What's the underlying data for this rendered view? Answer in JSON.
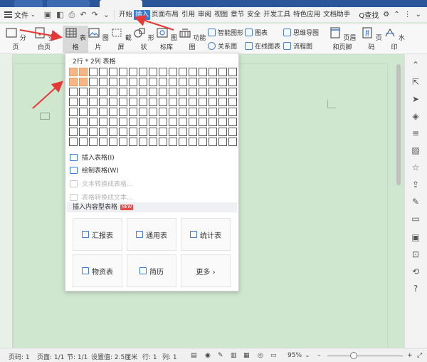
{
  "menu": {
    "file_label": "文件",
    "tabs": [
      "开始",
      "插入",
      "页面布局",
      "引用",
      "审阅",
      "视图",
      "章节",
      "安全",
      "开发工具",
      "特色应用",
      "文档助手"
    ],
    "selected_tab": "插入",
    "search_label": "Q查找"
  },
  "ribbon": {
    "left_buttons": [
      "分页",
      "空白页"
    ],
    "table_button": "表格",
    "buttons": [
      "图片",
      "截屏",
      "形状",
      "图标库",
      "功能图"
    ],
    "small_items": {
      "smart_art": "智能图形",
      "chart": "图表",
      "mind_map": "思维导图",
      "relation": "关系图",
      "online_chart": "在线图表",
      "flowchart": "流程图"
    },
    "right_buttons": [
      "页眉和页脚",
      "页码",
      "水印"
    ]
  },
  "table_dropdown": {
    "grid_label": "2行 * 2列 表格",
    "grid_cols": 17,
    "grid_rows": 8,
    "selected_rows": 2,
    "selected_cols": 2,
    "items": [
      {
        "label": "插入表格(I)",
        "enabled": true
      },
      {
        "label": "绘制表格(W)",
        "enabled": true
      },
      {
        "label": "文本转换成表格...",
        "enabled": false
      },
      {
        "label": "表格转换成文本...",
        "enabled": false
      }
    ],
    "section_label": "插入内容型表格",
    "new_badge": "NEW",
    "cards": [
      "汇报表",
      "通用表",
      "统计表",
      "物资表",
      "简历",
      "更多 ›"
    ]
  },
  "status": {
    "page_count": "页码: 1",
    "page": "页面: 1/1",
    "section": "节: 1/1",
    "setting": "设置值: 2.5厘米",
    "row": "行: 1",
    "col": "列: 1",
    "zoom": "95%"
  },
  "colors": {
    "accent": "#3a7bd5",
    "grid_selected": "#f5b584",
    "doc_background": "#cfe6cf",
    "arrow": "#e53935"
  }
}
